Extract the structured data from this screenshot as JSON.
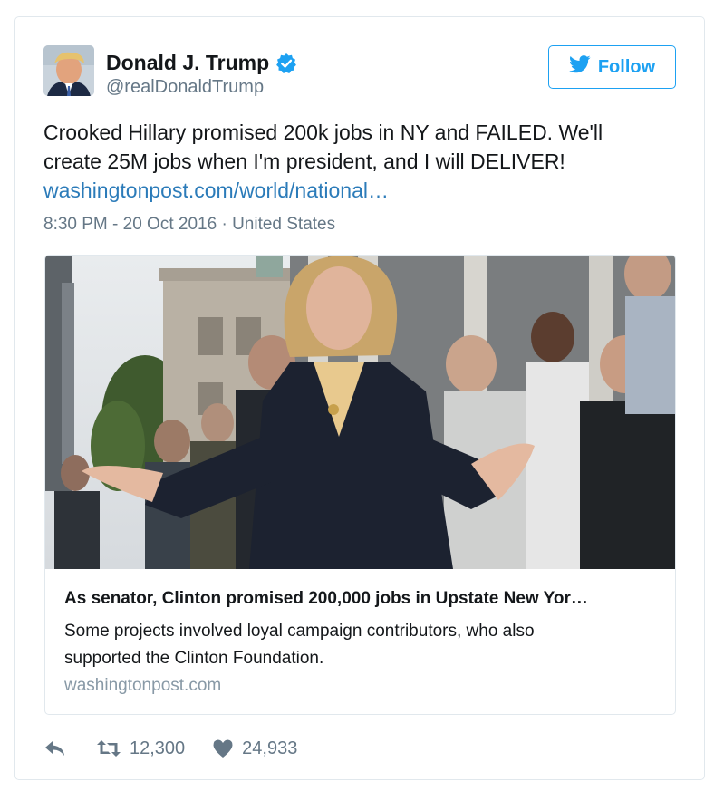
{
  "author": {
    "name": "Donald J. Trump",
    "handle": "@realDonaldTrump",
    "verified_icon": "verified-badge-icon"
  },
  "follow_button": {
    "label": "Follow",
    "icon": "twitter-bird-icon"
  },
  "tweet": {
    "text_lines": [
      "Crooked Hillary promised 200k jobs in NY and FAILED. We'll",
      "create 25M jobs when I'm president, and I will DELIVER!"
    ],
    "link": "washingtonpost.com/world/national…",
    "timestamp": "8:30 PM - 20 Oct 2016",
    "separator": "·",
    "location": "United States"
  },
  "card": {
    "title": "As senator, Clinton promised 200,000 jobs in Upstate New Yor…",
    "description_lines": [
      "Some projects involved loyal campaign contributors, who also",
      "supported the Clinton Foundation."
    ],
    "domain": "washingtonpost.com"
  },
  "actions": {
    "reply_icon": "reply-icon",
    "retweet_icon": "retweet-icon",
    "retweet_count": "12,300",
    "like_icon": "heart-icon",
    "like_count": "24,933"
  },
  "colors": {
    "accent": "#1da1f2",
    "link": "#2b7bb9",
    "text": "#14171a",
    "secondary": "#657786",
    "border": "#e1e8ed"
  }
}
